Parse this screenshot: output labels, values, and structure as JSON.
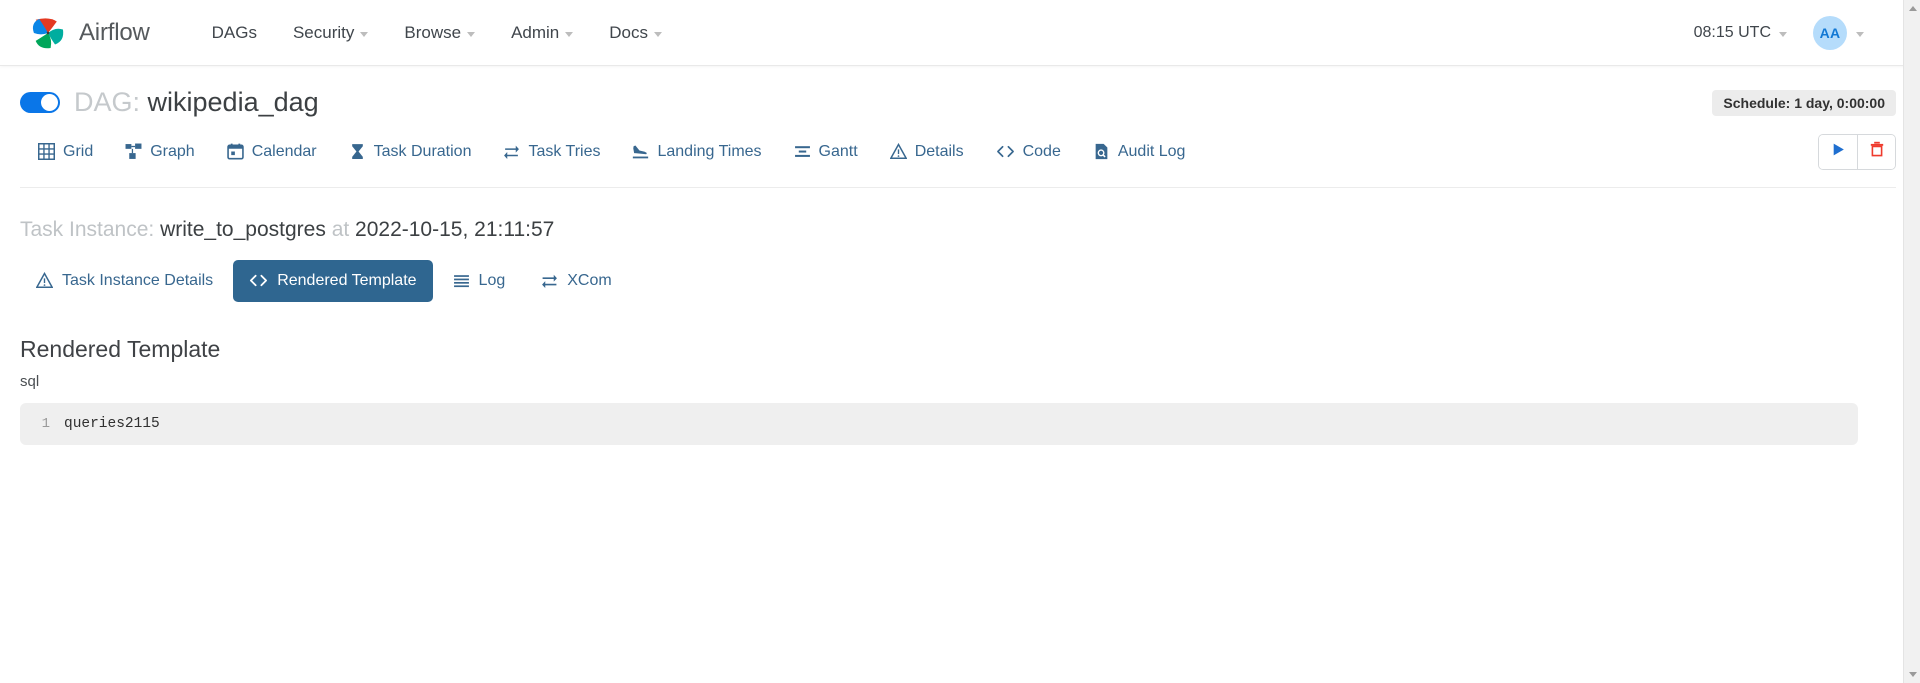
{
  "navbar": {
    "brand": "Airflow",
    "logo_icon": "airflow-pinwheel-logo",
    "links": [
      {
        "label": "DAGs",
        "has_caret": false,
        "icon": ""
      },
      {
        "label": "Security",
        "has_caret": true,
        "icon": "chevron-down-icon"
      },
      {
        "label": "Browse",
        "has_caret": true,
        "icon": "chevron-down-icon"
      },
      {
        "label": "Admin",
        "has_caret": true,
        "icon": "chevron-down-icon"
      },
      {
        "label": "Docs",
        "has_caret": true,
        "icon": "chevron-down-icon"
      }
    ],
    "clock": "08:15 UTC",
    "avatar_initials": "AA"
  },
  "dag": {
    "toggle_state": "on",
    "label": "DAG:",
    "name": "wikipedia_dag",
    "schedule_badge": "Schedule: 1 day, 0:00:00"
  },
  "dag_tabs": [
    {
      "label": "Grid",
      "icon": "grid-icon"
    },
    {
      "label": "Graph",
      "icon": "graph-nodes-icon"
    },
    {
      "label": "Calendar",
      "icon": "calendar-icon"
    },
    {
      "label": "Task Duration",
      "icon": "hourglass-icon"
    },
    {
      "label": "Task Tries",
      "icon": "retry-arrows-icon"
    },
    {
      "label": "Landing Times",
      "icon": "plane-landing-icon"
    },
    {
      "label": "Gantt",
      "icon": "gantt-bars-icon"
    },
    {
      "label": "Details",
      "icon": "warning-triangle-icon"
    },
    {
      "label": "Code",
      "icon": "code-brackets-icon"
    },
    {
      "label": "Audit Log",
      "icon": "document-search-icon"
    }
  ],
  "dag_actions": [
    {
      "name": "trigger-dag-button",
      "icon": "play-triangle-icon",
      "color": "#1f6fd0"
    },
    {
      "name": "delete-dag-button",
      "icon": "trash-icon",
      "color": "#ef3b2d"
    }
  ],
  "task_instance": {
    "prefix": "Task Instance:",
    "task_id": "write_to_postgres",
    "joiner": "at",
    "execution_date": "2022-10-15, 21:11:57"
  },
  "ti_tabs": [
    {
      "label": "Task Instance Details",
      "icon": "warning-triangle-icon",
      "active": false
    },
    {
      "label": "Rendered Template",
      "icon": "code-brackets-icon",
      "active": true
    },
    {
      "label": "Log",
      "icon": "lines-list-icon",
      "active": false
    },
    {
      "label": "XCom",
      "icon": "exchange-arrows-icon",
      "active": false
    }
  ],
  "rendered_template": {
    "heading": "Rendered Template",
    "field_key": "sql",
    "line_number": "1",
    "code": "queries2115"
  },
  "colors": {
    "accent_blue": "#017cee",
    "tab_link": "#38678f",
    "active_tab_bg": "#2f6690",
    "toggle_on": "#0a76e8",
    "delete_red": "#ef3b2d",
    "code_bg": "#efefef",
    "badge_bg": "#ececec"
  }
}
